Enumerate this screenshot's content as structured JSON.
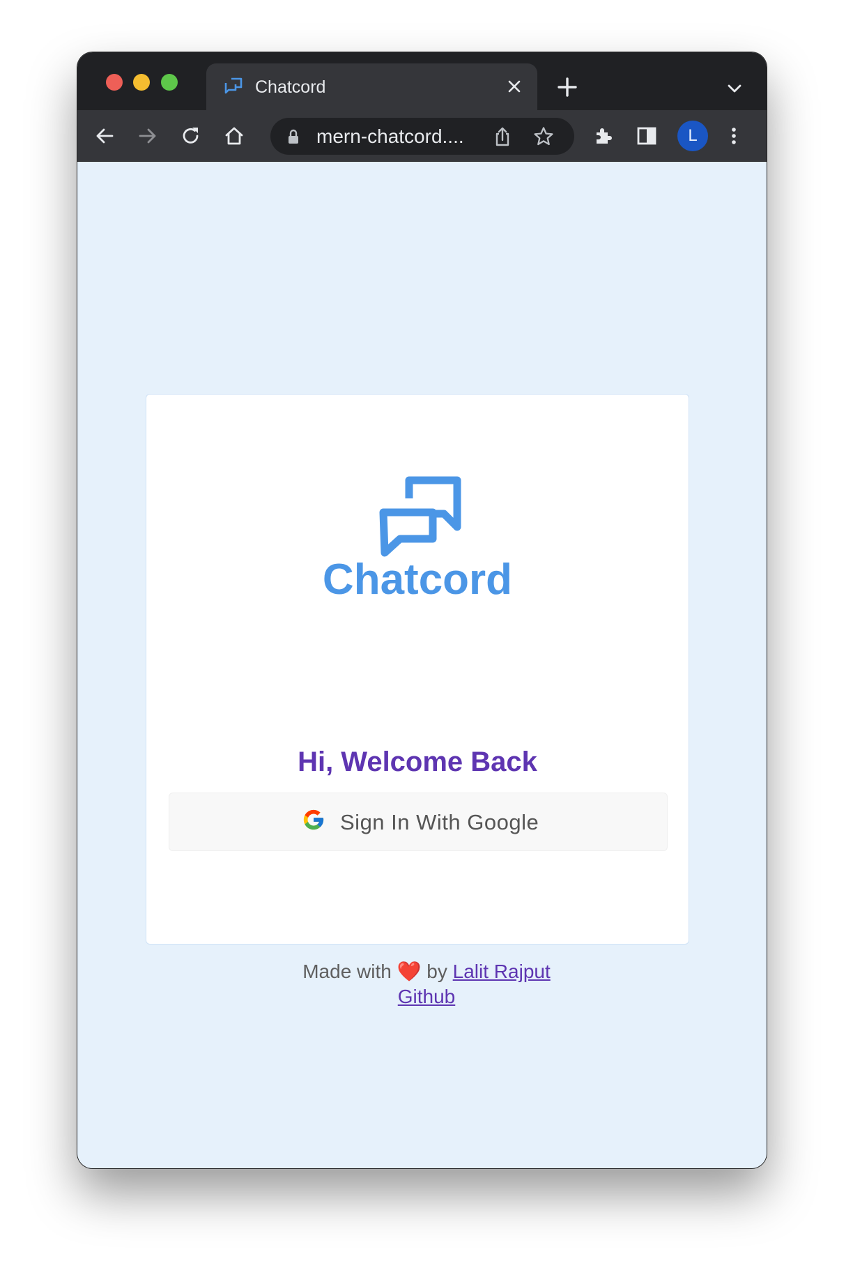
{
  "browser": {
    "tab_title": "Chatcord",
    "url_display": "mern-chatcord....",
    "profile_initial": "L",
    "icons": [
      "favicon-chat-icon",
      "close-tab-icon",
      "new-tab-icon",
      "tab-search-icon",
      "back-icon",
      "forward-icon",
      "reload-icon",
      "home-icon",
      "lock-icon",
      "share-icon",
      "bookmark-star-icon",
      "extensions-icon",
      "side-panel-icon",
      "more-menu-icon"
    ]
  },
  "login": {
    "logo_text": "Chatcord",
    "welcome": "Hi, Welcome Back",
    "google_button_label": "Sign In With Google"
  },
  "footer": {
    "made_with": "Made with",
    "heart": "❤️",
    "by": "by",
    "author_link": "Lalit Rajput",
    "github_link": "Github"
  },
  "colors": {
    "brand_blue": "#4b96e6",
    "welcome_purple": "#5e35b1",
    "page_background": "#e6f1fb",
    "chrome_dark": "#202124",
    "avatar_blue": "#1a56c4"
  }
}
